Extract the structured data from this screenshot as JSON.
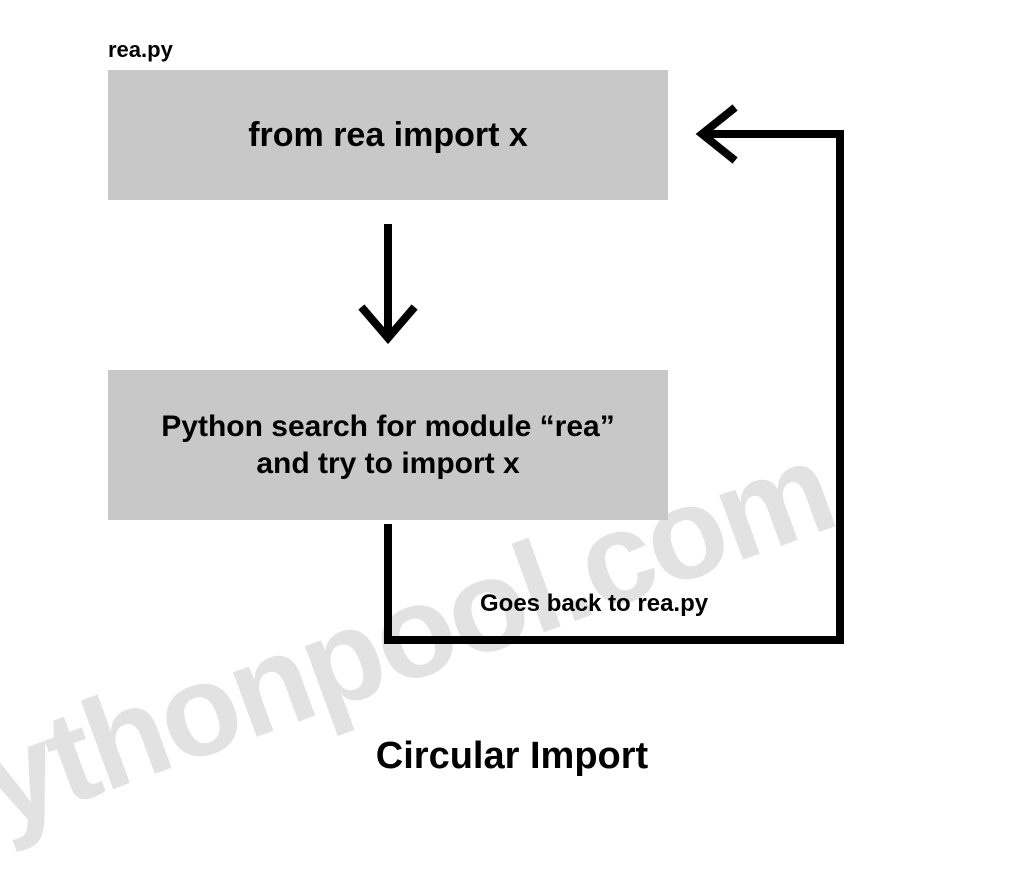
{
  "file_label": "rea.py",
  "box1_text": "from rea import x",
  "box2_text": "Python search for module “rea” and try to import x",
  "edge_label": "Goes back to rea.py",
  "title": "Circular Import",
  "watermark": "pythonpool.com"
}
